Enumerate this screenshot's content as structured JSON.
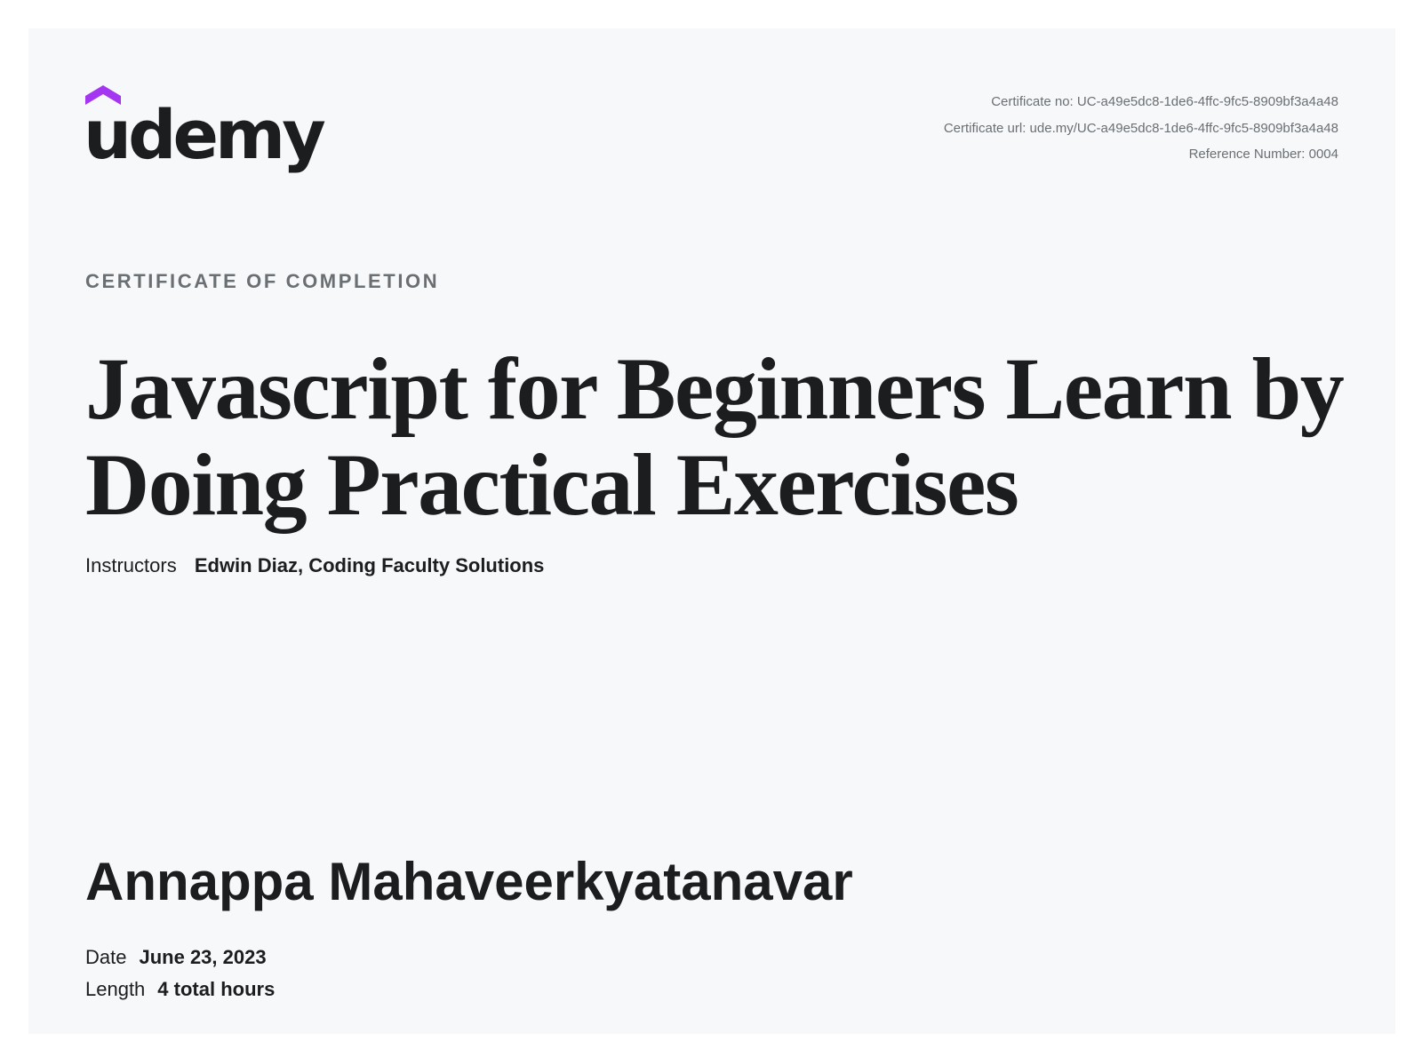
{
  "logo": {
    "text": "ûdemy",
    "brand_text_color": "#1c1d1f",
    "accent_color": "#a435f0"
  },
  "certificate": {
    "number_line": "Certificate no: UC-a49e5dc8-1de6-4ffc-9fc5-8909bf3a4a48",
    "url_line": "Certificate url: ude.my/UC-a49e5dc8-1de6-4ffc-9fc5-8909bf3a4a48",
    "reference_line": "Reference Number: 0004"
  },
  "heading": {
    "completion_label": "CERTIFICATE OF COMPLETION",
    "course_title": "Javascript for Beginners Learn by Doing Practical Exercises"
  },
  "instructors": {
    "label": "Instructors",
    "names": [
      "Edwin Diaz,",
      "Coding Faculty Solutions"
    ]
  },
  "recipient": {
    "name": "Annappa Mahaveerkyatanavar"
  },
  "details": {
    "date_label": "Date",
    "date_value": "June 23, 2023",
    "length_label": "Length",
    "length_value": "4 total hours"
  },
  "colors": {
    "background": "#f7f8fa",
    "text_primary": "#1c1d1f",
    "text_secondary": "#6a6f73"
  }
}
